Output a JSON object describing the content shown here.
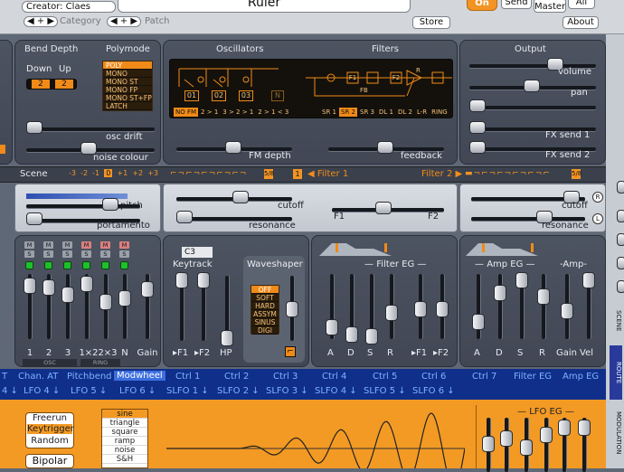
{
  "header": {
    "creator": "Creator: Claes",
    "category_label": "Category",
    "patch_label": "Patch",
    "patch_name": "Ruler",
    "store_label": "Store",
    "on_label": "On",
    "send_label": "Send",
    "master_label": "Master",
    "all_label": "All",
    "about_label": "About"
  },
  "bend": {
    "title": "Bend Depth",
    "down_label": "Down",
    "up_label": "Up",
    "down_value": "2",
    "up_value": "2"
  },
  "polymode": {
    "title": "Polymode",
    "options": [
      "POLY",
      "MONO",
      "MONO ST",
      "MONO FP",
      "MONO ST+FP",
      "LATCH"
    ],
    "selected": 0
  },
  "osc_controls": {
    "osc_drift": "osc drift",
    "noise_colour": "noise colour"
  },
  "oscfilt": {
    "osc_title": "Oscillators",
    "filt_title": "Filters",
    "osc_boxes": [
      "01",
      "02",
      "03"
    ],
    "n_label": "N",
    "f1": "F1",
    "f2": "F2",
    "fb": "FB",
    "r": "R",
    "fm_routes": [
      "NO FM",
      "2 > 1",
      "3 > 2 > 1",
      "2 > 1 < 3"
    ],
    "fm_selected": 0,
    "filter_routes": [
      "SR 1",
      "SR 2",
      "SR 3",
      "DL 1",
      "DL 2",
      "L-R",
      "RING"
    ],
    "filter_selected": 1,
    "fm_depth": "FM depth",
    "feedback": "feedback"
  },
  "output": {
    "title": "Output",
    "volume": "volume",
    "pan": "pan",
    "fx1": "FX send 1",
    "fx2": "FX send 2"
  },
  "scene": {
    "label": "Scene",
    "offsets": [
      "-3",
      "-2",
      "-1",
      "0",
      "+1",
      "+2",
      "+3"
    ],
    "selected": 3,
    "pitch": "pitch",
    "portamento": "portamento"
  },
  "filter1": {
    "label": "Filter 1",
    "num": "1",
    "cutoff": "cutoff",
    "resonance": "resonance",
    "f1": "F1",
    "f2": "F2",
    "mode": "5/8"
  },
  "filter2": {
    "label": "Filter 2",
    "cutoff": "cutoff",
    "resonance": "resonance",
    "mode": "5/8",
    "r": "R",
    "l": "L"
  },
  "mixer": {
    "labels": [
      "1",
      "2",
      "3",
      "1×2",
      "2×3",
      "N",
      "Gain"
    ],
    "osc_tag": "OSC",
    "ring_tag": "RING",
    "m": "M",
    "s": "S"
  },
  "keytrack": {
    "note": "C3",
    "title": "Keytrack",
    "f1": "F1",
    "f2": "F2",
    "hp": "HP"
  },
  "waveshaper": {
    "title": "Waveshaper",
    "options": [
      "OFF",
      "SOFT",
      "HARD",
      "ASSYM",
      "SINUS",
      "DIGI"
    ],
    "selected": 0
  },
  "filter_eg": {
    "title": "Filter EG",
    "labels": [
      "A",
      "D",
      "S",
      "R",
      "F1",
      "F2"
    ]
  },
  "amp_eg": {
    "title": "Amp EG",
    "amp_title": "Amp",
    "labels": [
      "A",
      "D",
      "S",
      "R"
    ],
    "gain": "Gain",
    "vel": "Vel"
  },
  "modbar": {
    "row1": [
      "T",
      "Chan. AT",
      "Pitchbend",
      "Modwheel",
      "Ctrl 1",
      "Ctrl 2",
      "Ctrl 3",
      "Ctrl 4",
      "Ctrl 5",
      "Ctrl 6",
      "Ctrl 7",
      "Filter EG",
      "Amp EG"
    ],
    "row1_selected": 3,
    "row2": [
      "LFO 4",
      "LFO 5",
      "LFO 6",
      "SLFO 1",
      "SLFO 2",
      "SLFO 3",
      "SLFO 4",
      "SLFO 5",
      "SLFO 6"
    ],
    "left_row2": "4"
  },
  "lfo": {
    "triggers": [
      "Freerun",
      "Keytrigger",
      "Random"
    ],
    "trigger_selected": 1,
    "bipolar": "Bipolar",
    "shapes": [
      "sine",
      "triangle",
      "square",
      "ramp",
      "noise",
      "S&H"
    ],
    "shape_selected": 0,
    "eg_title": "LFO EG"
  },
  "side_tabs": {
    "scene": "SCENE",
    "route": "ROUTE",
    "modulation": "MODULATION"
  },
  "colors": {
    "accent": "#f39a24",
    "panel": "#464c58",
    "modbar": "#0f2f8a"
  }
}
